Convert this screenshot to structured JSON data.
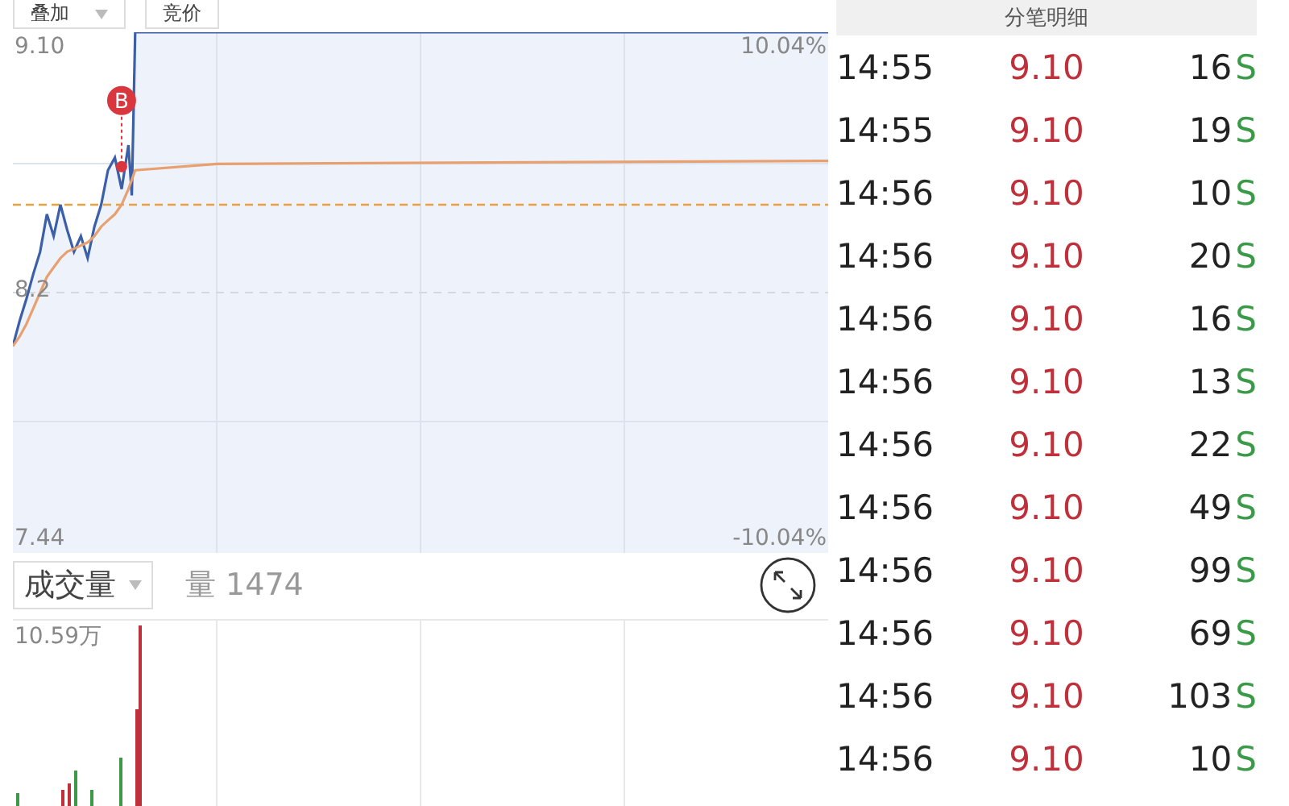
{
  "toolbar": {
    "buttons": [
      {
        "label": "叠加",
        "dropdown": true
      },
      {
        "label": "竞价",
        "dropdown": false
      }
    ]
  },
  "price_chart": {
    "left_labels": [
      "9.10",
      "8.2",
      "7.44"
    ],
    "right_labels": [
      "10.04%",
      "-10.04%"
    ],
    "marker_label": "B"
  },
  "volume": {
    "indicator": "成交量",
    "reading": "量 1474",
    "max_label": "10.59万"
  },
  "trades": {
    "title": "分笔明细",
    "rows": [
      {
        "time": "14:55",
        "price": "9.10",
        "volume": "16",
        "side": "S"
      },
      {
        "time": "14:55",
        "price": "9.10",
        "volume": "19",
        "side": "S"
      },
      {
        "time": "14:56",
        "price": "9.10",
        "volume": "10",
        "side": "S"
      },
      {
        "time": "14:56",
        "price": "9.10",
        "volume": "20",
        "side": "S"
      },
      {
        "time": "14:56",
        "price": "9.10",
        "volume": "16",
        "side": "S"
      },
      {
        "time": "14:56",
        "price": "9.10",
        "volume": "13",
        "side": "S"
      },
      {
        "time": "14:56",
        "price": "9.10",
        "volume": "22",
        "side": "S"
      },
      {
        "time": "14:56",
        "price": "9.10",
        "volume": "49",
        "side": "S"
      },
      {
        "time": "14:56",
        "price": "9.10",
        "volume": "99",
        "side": "S"
      },
      {
        "time": "14:56",
        "price": "9.10",
        "volume": "69",
        "side": "S"
      },
      {
        "time": "14:56",
        "price": "9.10",
        "volume": "103",
        "side": "S"
      },
      {
        "time": "14:56",
        "price": "9.10",
        "volume": "10",
        "side": "S"
      }
    ]
  }
}
